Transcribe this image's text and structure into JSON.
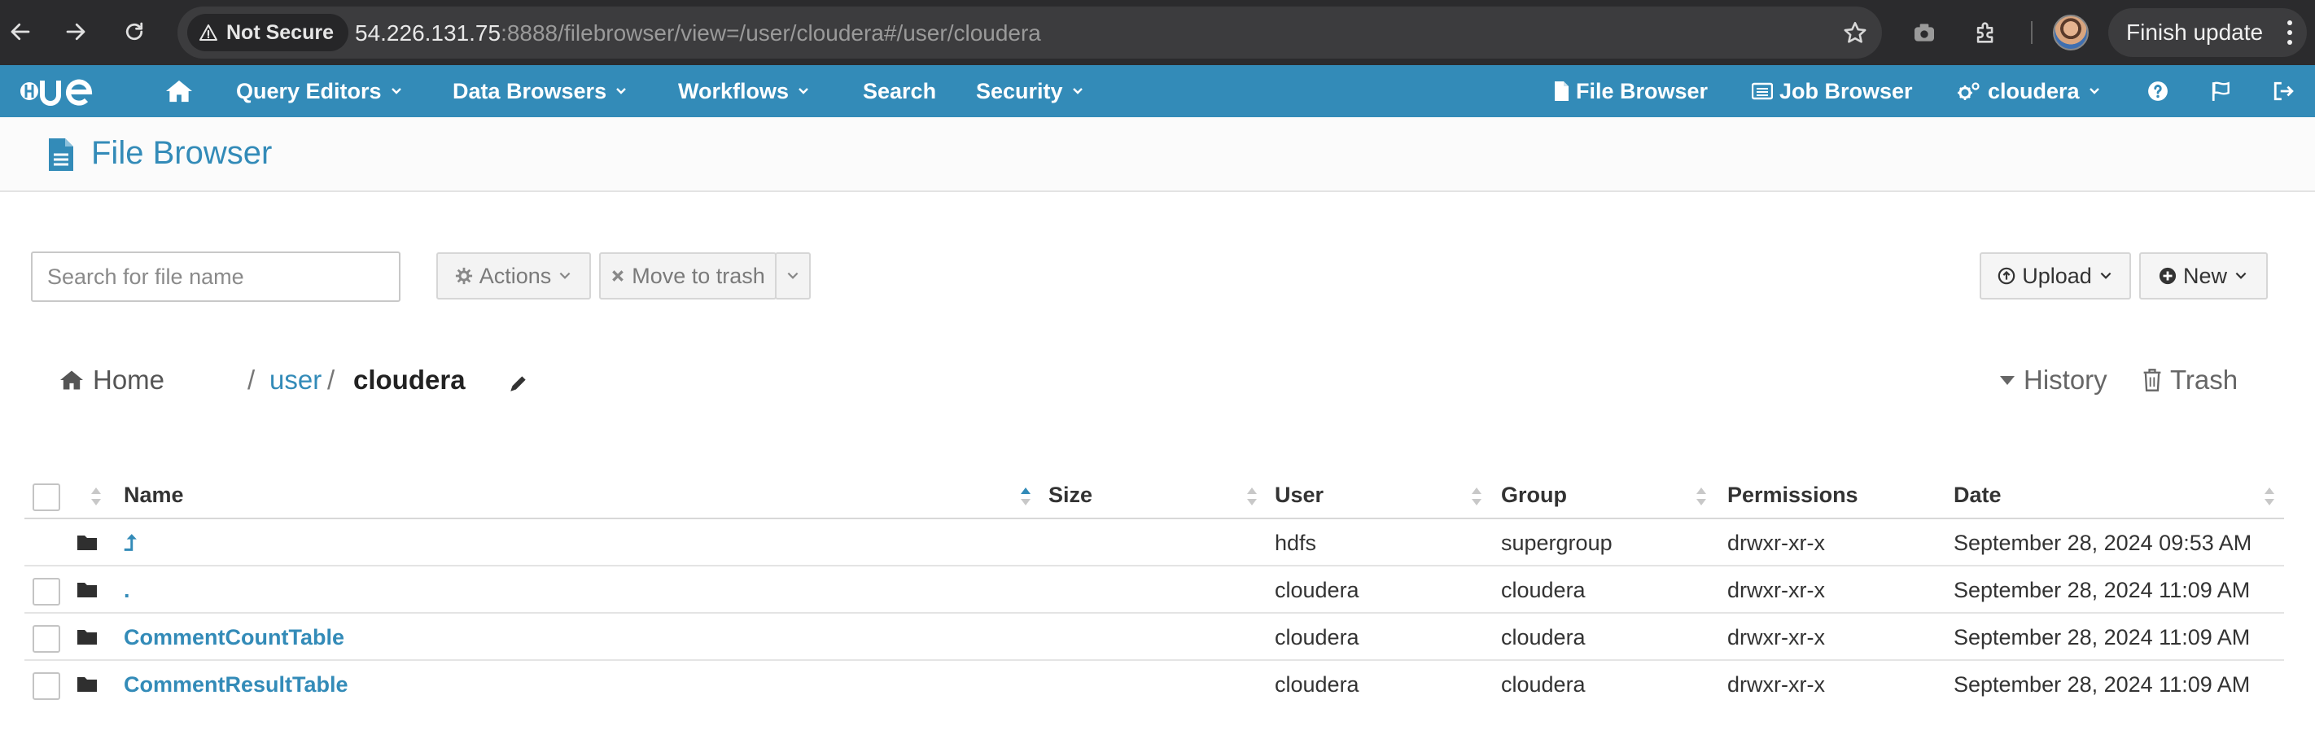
{
  "browser": {
    "security_label": "Not Secure",
    "url_host": "54.226.131.75",
    "url_rest": ":8888/filebrowser/view=/user/cloudera#/user/cloudera",
    "finish_update": "Finish update"
  },
  "topnav": {
    "logo": "HUE",
    "items": [
      {
        "label": "Query Editors"
      },
      {
        "label": "Data Browsers"
      },
      {
        "label": "Workflows"
      },
      {
        "label": "Search"
      },
      {
        "label": "Security"
      }
    ],
    "file_browser": "File Browser",
    "job_browser": "Job Browser",
    "user": "cloudera"
  },
  "page": {
    "title": "File Browser"
  },
  "toolbar": {
    "search_placeholder": "Search for file name",
    "actions": "Actions",
    "move_to_trash": "Move to trash",
    "upload": "Upload",
    "new": "New"
  },
  "breadcrumb": {
    "home": "Home",
    "sep": "/",
    "user": "user",
    "current": "cloudera",
    "history": "History",
    "trash": "Trash"
  },
  "table": {
    "columns": [
      "Name",
      "Size",
      "User",
      "Group",
      "Permissions",
      "Date"
    ],
    "rows": [
      {
        "name": "⮥",
        "size": "",
        "user": "hdfs",
        "group": "supergroup",
        "permissions": "drwxr-xr-x",
        "date": "September 28, 2024 09:53 AM",
        "checkbox": false
      },
      {
        "name": ".",
        "size": "",
        "user": "cloudera",
        "group": "cloudera",
        "permissions": "drwxr-xr-x",
        "date": "September 28, 2024 11:09 AM",
        "checkbox": true
      },
      {
        "name": "CommentCountTable",
        "size": "",
        "user": "cloudera",
        "group": "cloudera",
        "permissions": "drwxr-xr-x",
        "date": "September 28, 2024 11:09 AM",
        "checkbox": true
      },
      {
        "name": "CommentResultTable",
        "size": "",
        "user": "cloudera",
        "group": "cloudera",
        "permissions": "drwxr-xr-x",
        "date": "September 28, 2024 11:09 AM",
        "checkbox": true
      }
    ]
  },
  "colors": {
    "hue_blue": "#338bb8",
    "chrome_bg": "#2b2b2d"
  }
}
